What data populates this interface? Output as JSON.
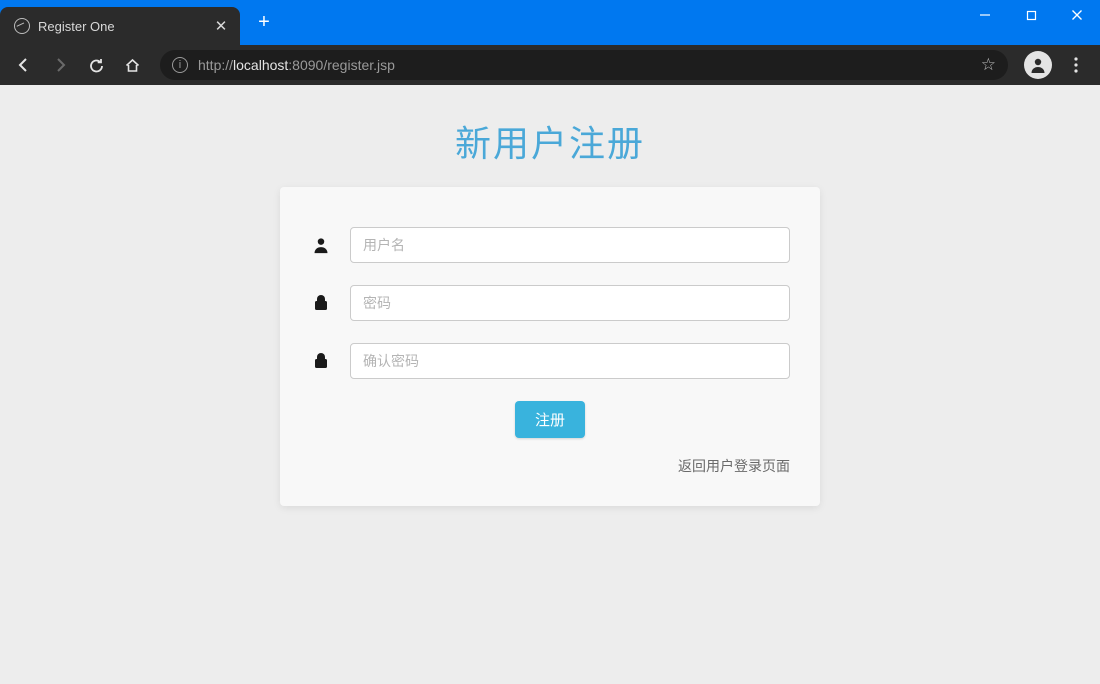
{
  "window": {
    "tab_title": "Register One"
  },
  "address": {
    "prefix": "http://",
    "host": "localhost",
    "port_path": ":8090/register.jsp"
  },
  "page": {
    "title": "新用户注册"
  },
  "form": {
    "username_placeholder": "用户名",
    "password_placeholder": "密码",
    "confirm_placeholder": "确认密码",
    "submit_label": "注册",
    "back_link_label": "返回用户登录页面"
  }
}
